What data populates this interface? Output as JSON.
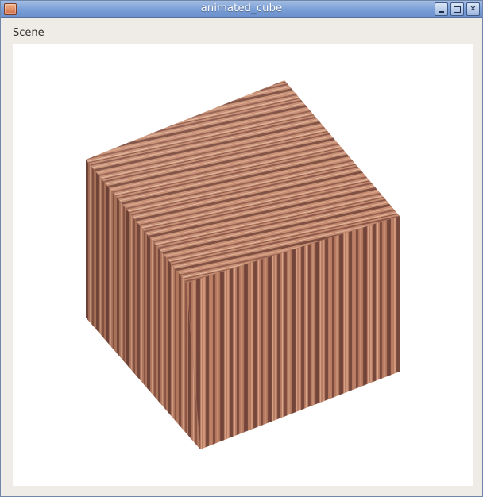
{
  "window": {
    "title": "animated_cube",
    "controls": {
      "minimize": "",
      "maximize": "",
      "close": "✕"
    }
  },
  "menubar": {
    "items": [
      {
        "label": "Scene"
      }
    ]
  },
  "viewport": {
    "content": "textured-cube",
    "colors": {
      "background": "#ffffff",
      "wood_light": "#d8a385",
      "wood_mid": "#b97c62",
      "wood_dark": "#7a4a3c"
    }
  }
}
